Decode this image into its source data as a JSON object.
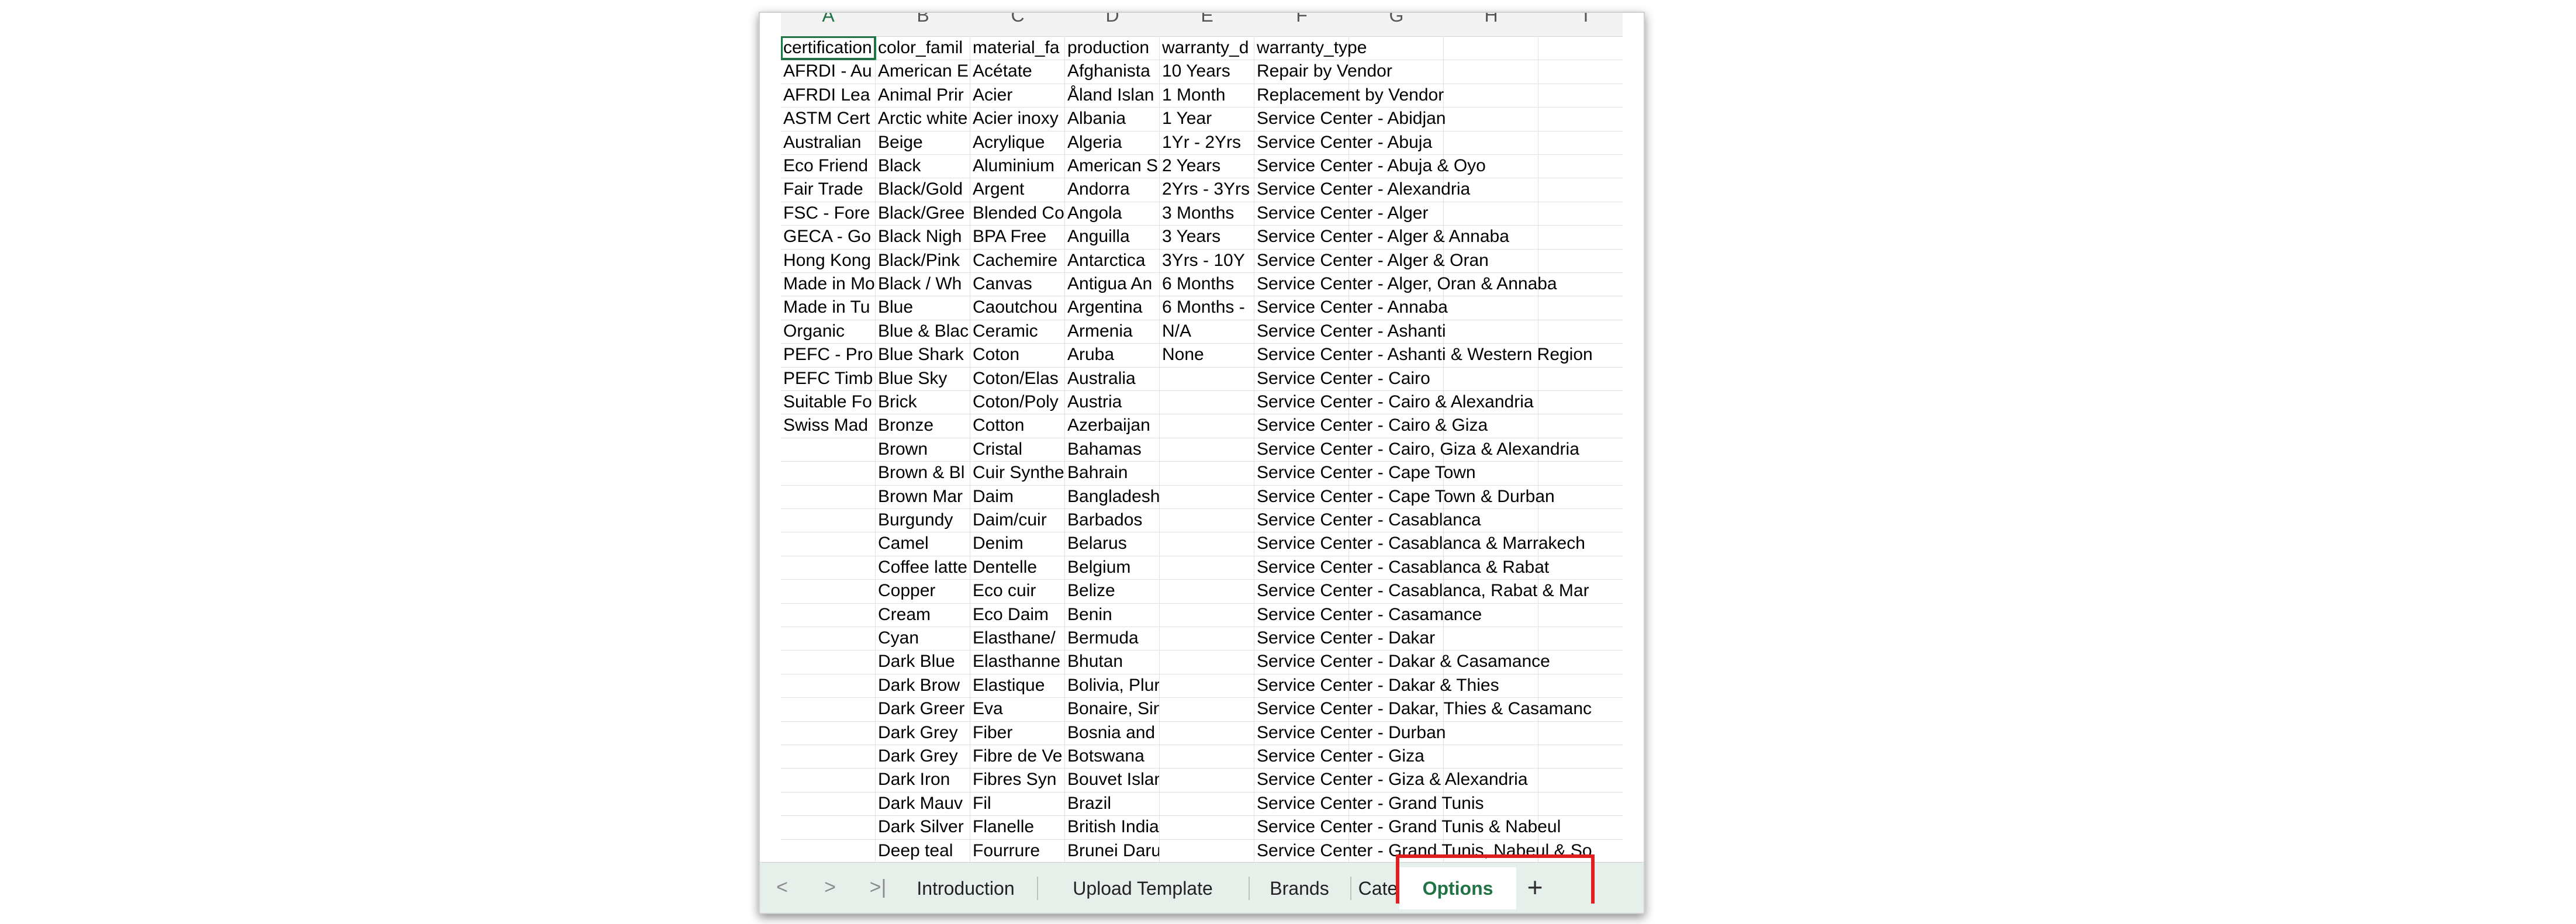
{
  "columns": [
    "A",
    "B",
    "C",
    "D",
    "E",
    "F",
    "G",
    "H",
    "I"
  ],
  "rows": [
    [
      "certification",
      "color_famil",
      "material_fa",
      "production",
      "warranty_d",
      "warranty_type"
    ],
    [
      "AFRDI - Au",
      "American E",
      "Acétate",
      "Afghanista",
      "10 Years",
      "Repair by Vendor"
    ],
    [
      "AFRDI Lea",
      "Animal Prir",
      "Acier",
      "Åland Islan",
      "1 Month",
      "Replacement by Vendor"
    ],
    [
      "ASTM Cert",
      "Arctic white",
      "Acier inoxy",
      "Albania",
      "1 Year",
      "Service Center - Abidjan"
    ],
    [
      "Australian",
      "Beige",
      "Acrylique",
      "Algeria",
      "1Yr - 2Yrs",
      "Service Center - Abuja"
    ],
    [
      "Eco Friend",
      "Black",
      "Aluminium",
      "American S",
      "2 Years",
      "Service Center - Abuja & Oyo"
    ],
    [
      "Fair Trade",
      "Black/Gold",
      "Argent",
      "Andorra",
      "2Yrs - 3Yrs",
      "Service Center - Alexandria"
    ],
    [
      "FSC - Fore",
      "Black/Gree",
      "Blended Co",
      "Angola",
      "3 Months",
      "Service Center - Alger"
    ],
    [
      "GECA - Go",
      "Black Nigh",
      "BPA Free",
      "Anguilla",
      "3 Years",
      "Service Center - Alger & Annaba"
    ],
    [
      "Hong Kong",
      "Black/Pink",
      "Cachemire",
      "Antarctica",
      "3Yrs - 10Y",
      "Service Center - Alger & Oran"
    ],
    [
      "Made in Mo",
      "Black / Wh",
      "Canvas",
      "Antigua An",
      "6 Months",
      "Service Center - Alger, Oran & Annaba"
    ],
    [
      "Made in Tu",
      "Blue",
      "Caoutchou",
      "Argentina",
      "6 Months -",
      "Service Center - Annaba"
    ],
    [
      "Organic",
      "Blue & Blac",
      "Ceramic",
      "Armenia",
      "N/A",
      "Service Center - Ashanti"
    ],
    [
      "PEFC - Pro",
      "Blue Shark",
      "Coton",
      "Aruba",
      "None",
      "Service Center - Ashanti & Western Region"
    ],
    [
      "PEFC Timb",
      "Blue Sky",
      "Coton/Elas",
      "Australia",
      "",
      "Service Center - Cairo"
    ],
    [
      "Suitable Fo",
      "Brick",
      "Coton/Poly",
      "Austria",
      "",
      "Service Center - Cairo & Alexandria"
    ],
    [
      "Swiss Mad",
      "Bronze",
      "Cotton",
      "Azerbaijan",
      "",
      "Service Center - Cairo & Giza"
    ],
    [
      "",
      "Brown",
      "Cristal",
      "Bahamas",
      "",
      "Service Center - Cairo, Giza & Alexandria"
    ],
    [
      "",
      "Brown & Bl",
      "Cuir Synthe",
      "Bahrain",
      "",
      "Service Center - Cape Town"
    ],
    [
      "",
      "Brown Mar",
      "Daim",
      "Bangladesh",
      "",
      "Service Center - Cape Town & Durban"
    ],
    [
      "",
      "Burgundy",
      "Daim/cuir",
      "Barbados",
      "",
      "Service Center - Casablanca"
    ],
    [
      "",
      "Camel",
      "Denim",
      "Belarus",
      "",
      "Service Center - Casablanca & Marrakech"
    ],
    [
      "",
      "Coffee latte",
      "Dentelle",
      "Belgium",
      "",
      "Service Center - Casablanca & Rabat"
    ],
    [
      "",
      "Copper",
      "Eco cuir",
      "Belize",
      "",
      "Service Center - Casablanca, Rabat & Mar"
    ],
    [
      "",
      "Cream",
      "Eco Daim",
      "Benin",
      "",
      "Service Center - Casamance"
    ],
    [
      "",
      "Cyan",
      "Elasthane/",
      "Bermuda",
      "",
      "Service Center - Dakar"
    ],
    [
      "",
      "Dark Blue",
      "Elasthanne",
      "Bhutan",
      "",
      "Service Center - Dakar & Casamance"
    ],
    [
      "",
      "Dark Brow",
      "Elastique",
      "Bolivia, Plurinational S",
      "",
      "Service Center - Dakar & Thies"
    ],
    [
      "",
      "Dark Greer",
      "Eva",
      "Bonaire, Sint Eustatius",
      "",
      "Service Center - Dakar, Thies & Casamanc"
    ],
    [
      "",
      "Dark Grey",
      "Fiber",
      "Bosnia and Herzegovi",
      "",
      "Service Center - Durban"
    ],
    [
      "",
      "Dark Grey",
      "Fibre de Ve",
      "Botswana",
      "",
      "Service Center - Giza"
    ],
    [
      "",
      "Dark Iron",
      "Fibres Syn",
      "Bouvet Island",
      "",
      "Service Center - Giza & Alexandria"
    ],
    [
      "",
      "Dark Mauv",
      "Fil",
      "Brazil",
      "",
      "Service Center - Grand Tunis"
    ],
    [
      "",
      "Dark Silver",
      "Flanelle",
      "British Indian Ocean T",
      "",
      "Service Center - Grand Tunis & Nabeul"
    ],
    [
      "",
      "Deep teal",
      "Fourrure",
      "Brunei Darussalam",
      "",
      "Service Center - Grand Tunis, Nabeul & So"
    ]
  ],
  "tabs": [
    "Introduction",
    "Upload Template",
    "Brands",
    "Categories",
    "Options"
  ],
  "active_tab": "Options",
  "nav": {
    "prev": "<",
    "next": ">",
    "last": ">|"
  },
  "add_sheet": "+",
  "colors": {
    "accent": "#217346",
    "tabbar": "#e6efe9",
    "highlight": "#e02020"
  }
}
